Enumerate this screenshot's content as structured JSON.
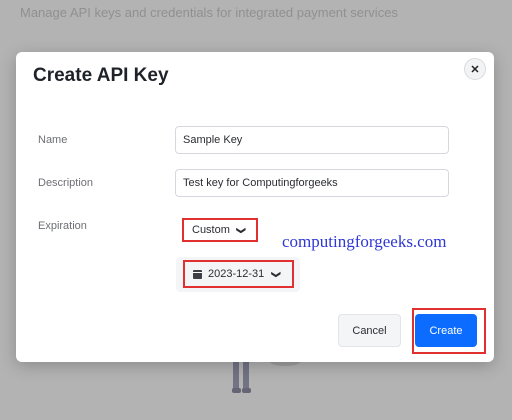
{
  "background": {
    "subtitle": "Manage API keys and credentials for integrated payment services"
  },
  "modal": {
    "title": "Create API Key",
    "close_icon": "close-icon",
    "fields": {
      "name": {
        "label": "Name",
        "value": "Sample Key"
      },
      "description": {
        "label": "Description",
        "value": "Test key for Computingforgeeks"
      },
      "expiration": {
        "label": "Expiration",
        "selected": "Custom",
        "date": "2023-12-31"
      }
    },
    "buttons": {
      "cancel": "Cancel",
      "create": "Create"
    }
  },
  "watermark": "computingforgeeks.com",
  "colors": {
    "primary": "#0b6cff",
    "highlight_border": "#e03030",
    "watermark": "#2f37d4"
  }
}
